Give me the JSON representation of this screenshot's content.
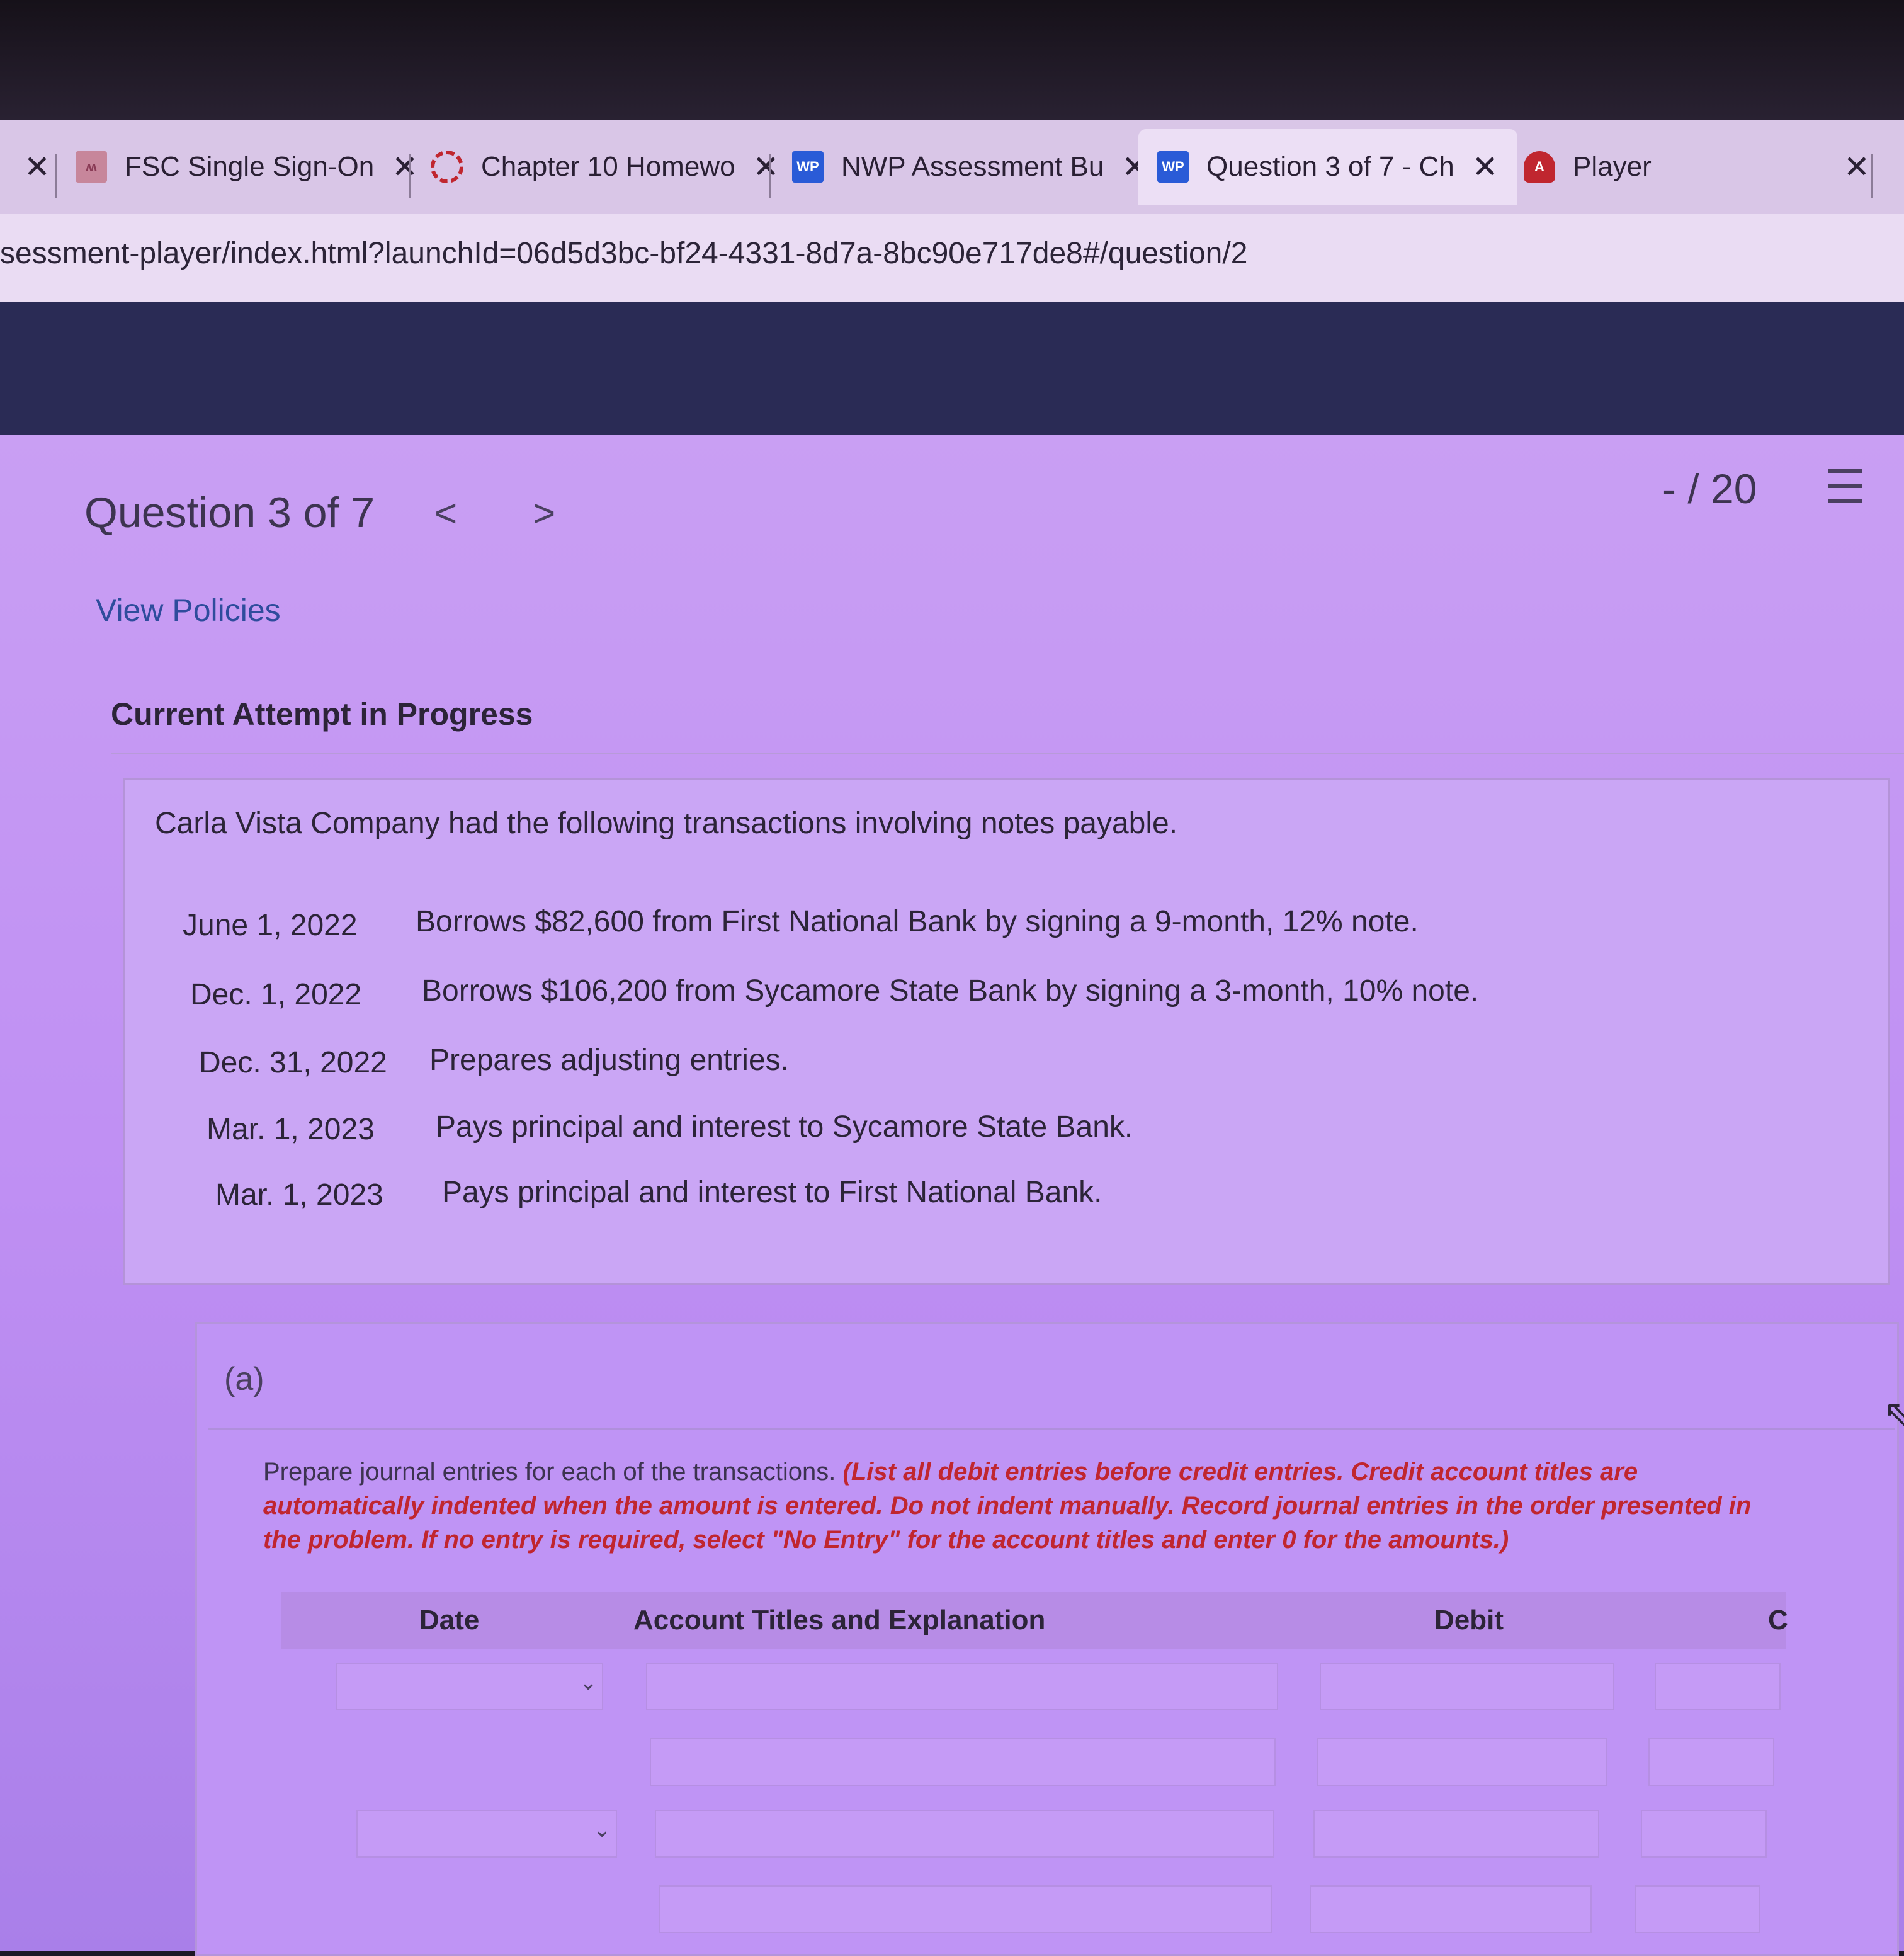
{
  "browser": {
    "tabs": [
      {
        "label": "FSC Single Sign-On",
        "icon": "fsc-logo-icon"
      },
      {
        "label": "Chapter 10 Homewo",
        "icon": "loading-icon"
      },
      {
        "label": "NWP Assessment Bu",
        "icon": "wp-icon"
      },
      {
        "label": "Question 3 of 7 - Ch",
        "icon": "wp-icon",
        "active": true
      },
      {
        "label": "Player",
        "icon": "angular-icon"
      }
    ],
    "wp_icon_text": "WP",
    "angular_icon_text": "A",
    "url": "sessment-player/index.html?launchId=06d5d3bc-bf24-4331-8d7a-8bc90e717de8#/question/2"
  },
  "header": {
    "question_title": "Question 3 of 7",
    "prev_glyph": "<",
    "next_glyph": ">",
    "score": "- / 20"
  },
  "links": {
    "view_policies": "View Policies"
  },
  "attempt_status": "Current Attempt in Progress",
  "problem": {
    "intro": "Carla Vista Company had the following transactions involving notes payable.",
    "transactions": [
      {
        "date": "June 1, 2022",
        "description": "Borrows $82,600 from First National Bank by signing a 9-month, 12% note."
      },
      {
        "date": "Dec. 1, 2022",
        "description": "Borrows $106,200 from Sycamore State Bank by signing a 3-month, 10% note."
      },
      {
        "date": "Dec. 31, 2022",
        "description": "Prepares adjusting entries."
      },
      {
        "date": "Mar. 1, 2023",
        "description": "Pays principal and interest to Sycamore State Bank."
      },
      {
        "date": "Mar. 1, 2023",
        "description": "Pays principal and interest to First National Bank."
      }
    ]
  },
  "part_a": {
    "label": "(a)",
    "instruction": "Prepare journal entries for each of the transactions.",
    "instruction_note": "(List all debit entries before credit entries. Credit account titles are automatically indented when the amount is entered. Do not indent manually. Record journal entries in the order presented in the problem. If no entry is required, select \"No Entry\" for the account titles and enter 0 for the amounts.)",
    "columns": [
      "Date",
      "Account Titles and Explanation",
      "Debit",
      "C"
    ]
  },
  "colors": {
    "accent_link": "#2e4c9c",
    "instruction_red": "#c0262f",
    "nav_band": "#2a2b55"
  }
}
